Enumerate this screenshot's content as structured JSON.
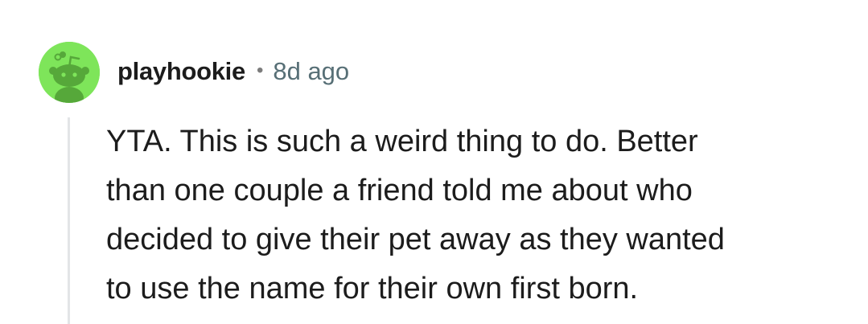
{
  "comment": {
    "avatar": {
      "icon": "reddit-snoo-avatar-icon",
      "background_color": "#7ee55a",
      "figure_color": "#56a83a"
    },
    "author": "playhookie",
    "separator": "•",
    "timestamp": "8d ago",
    "body_lines": [
      "YTA. This is such a weird thing to do. Better",
      "than one couple a friend told me about who",
      "decided to give their pet away as they wanted",
      "to use the name for their own first born."
    ]
  }
}
